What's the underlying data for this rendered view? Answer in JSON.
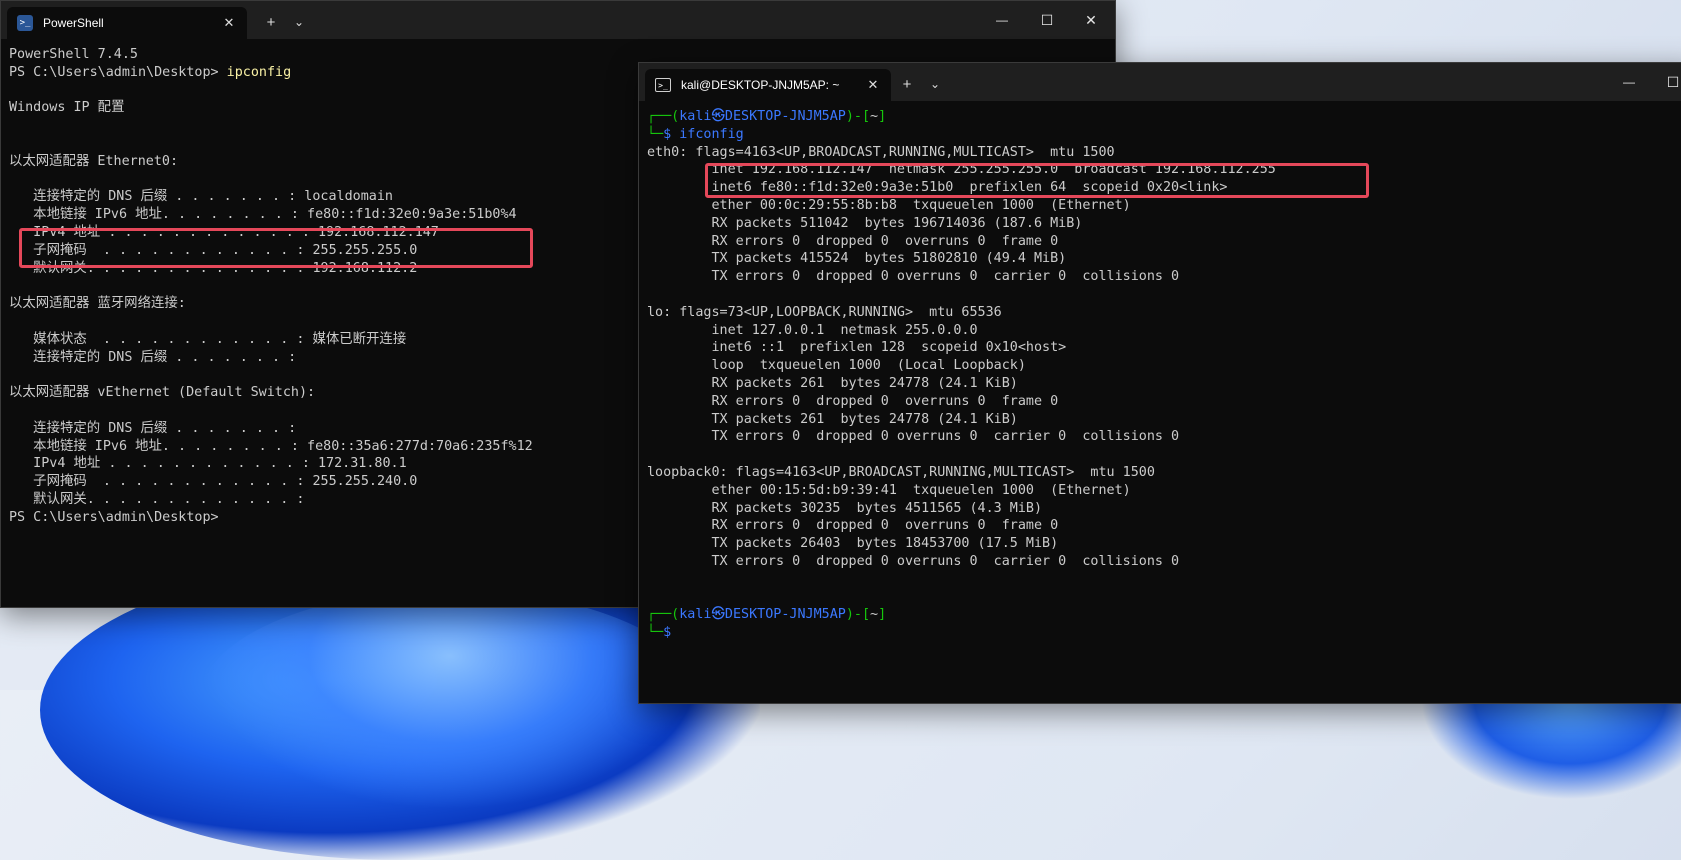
{
  "powershell": {
    "tab_title": "PowerShell",
    "tab_icon": "powershell-icon",
    "new_tab": "+",
    "dropdown": "⌄",
    "minimize": "—",
    "maximize": "☐",
    "close": "✕",
    "lines": [
      {
        "text": "PowerShell 7.4.5"
      },
      {
        "prompt": "PS C:\\Users\\admin\\Desktop> ",
        "cmd": "ipconfig"
      },
      {
        "text": ""
      },
      {
        "text": "Windows IP 配置"
      },
      {
        "text": ""
      },
      {
        "text": ""
      },
      {
        "text": "以太网适配器 Ethernet0:"
      },
      {
        "text": ""
      },
      {
        "text": "   连接特定的 DNS 后缀 . . . . . . . : localdomain"
      },
      {
        "text": "   本地链接 IPv6 地址. . . . . . . . : fe80::f1d:32e0:9a3e:51b0%4"
      },
      {
        "text": "   IPv4 地址 . . . . . . . . . . . . : 192.168.112.147"
      },
      {
        "text": "   子网掩码  . . . . . . . . . . . . : 255.255.255.0"
      },
      {
        "text": "   默认网关. . . . . . . . . . . . . : 192.168.112.2"
      },
      {
        "text": ""
      },
      {
        "text": "以太网适配器 蓝牙网络连接:"
      },
      {
        "text": ""
      },
      {
        "text": "   媒体状态  . . . . . . . . . . . . : 媒体已断开连接"
      },
      {
        "text": "   连接特定的 DNS 后缀 . . . . . . . :"
      },
      {
        "text": ""
      },
      {
        "text": "以太网适配器 vEthernet (Default Switch):"
      },
      {
        "text": ""
      },
      {
        "text": "   连接特定的 DNS 后缀 . . . . . . . :"
      },
      {
        "text": "   本地链接 IPv6 地址. . . . . . . . : fe80::35a6:277d:70a6:235f%12"
      },
      {
        "text": "   IPv4 地址 . . . . . . . . . . . . : 172.31.80.1"
      },
      {
        "text": "   子网掩码  . . . . . . . . . . . . : 255.255.240.0"
      },
      {
        "text": "   默认网关. . . . . . . . . . . . . :"
      },
      {
        "prompt": "PS C:\\Users\\admin\\Desktop>",
        "cmd": ""
      }
    ]
  },
  "kali": {
    "tab_title": "kali@DESKTOP-JNJM5AP: ~",
    "tab_icon": "terminal-icon",
    "new_tab": "+",
    "dropdown": "⌄",
    "minimize": "—",
    "maximize": "☐",
    "close": "✕",
    "prompt_user": "kali",
    "prompt_at": "㉿",
    "prompt_host": "DESKTOP-JNJM5AP",
    "prompt_dir": "~",
    "command": "ifconfig",
    "output": [
      "eth0: flags=4163<UP,BROADCAST,RUNNING,MULTICAST>  mtu 1500",
      "        inet 192.168.112.147  netmask 255.255.255.0  broadcast 192.168.112.255",
      "        inet6 fe80::f1d:32e0:9a3e:51b0  prefixlen 64  scopeid 0x20<link>",
      "        ether 00:0c:29:55:8b:b8  txqueuelen 1000  (Ethernet)",
      "        RX packets 511042  bytes 196714036 (187.6 MiB)",
      "        RX errors 0  dropped 0  overruns 0  frame 0",
      "        TX packets 415524  bytes 51802810 (49.4 MiB)",
      "        TX errors 0  dropped 0 overruns 0  carrier 0  collisions 0",
      "",
      "lo: flags=73<UP,LOOPBACK,RUNNING>  mtu 65536",
      "        inet 127.0.0.1  netmask 255.0.0.0",
      "        inet6 ::1  prefixlen 128  scopeid 0x10<host>",
      "        loop  txqueuelen 1000  (Local Loopback)",
      "        RX packets 261  bytes 24778 (24.1 KiB)",
      "        RX errors 0  dropped 0  overruns 0  frame 0",
      "        TX packets 261  bytes 24778 (24.1 KiB)",
      "        TX errors 0  dropped 0 overruns 0  carrier 0  collisions 0",
      "",
      "loopback0: flags=4163<UP,BROADCAST,RUNNING,MULTICAST>  mtu 1500",
      "        ether 00:15:5d:b9:39:41  txqueuelen 1000  (Ethernet)",
      "        RX packets 30235  bytes 4511565 (4.3 MiB)",
      "        RX errors 0  dropped 0  overruns 0  frame 0",
      "        TX packets 26403  bytes 18453700 (17.5 MiB)",
      "        TX errors 0  dropped 0 overruns 0  carrier 0  collisions 0",
      "",
      ""
    ]
  },
  "colors": {
    "terminal_bg": "#0c0c0c",
    "titlebar_bg": "#1f1f1f",
    "highlight": "#e5485a",
    "kali_prompt_blue": "#3b78ff",
    "kali_prompt_green": "#16c60c",
    "ps_command_yellow": "#f9f1a5"
  }
}
